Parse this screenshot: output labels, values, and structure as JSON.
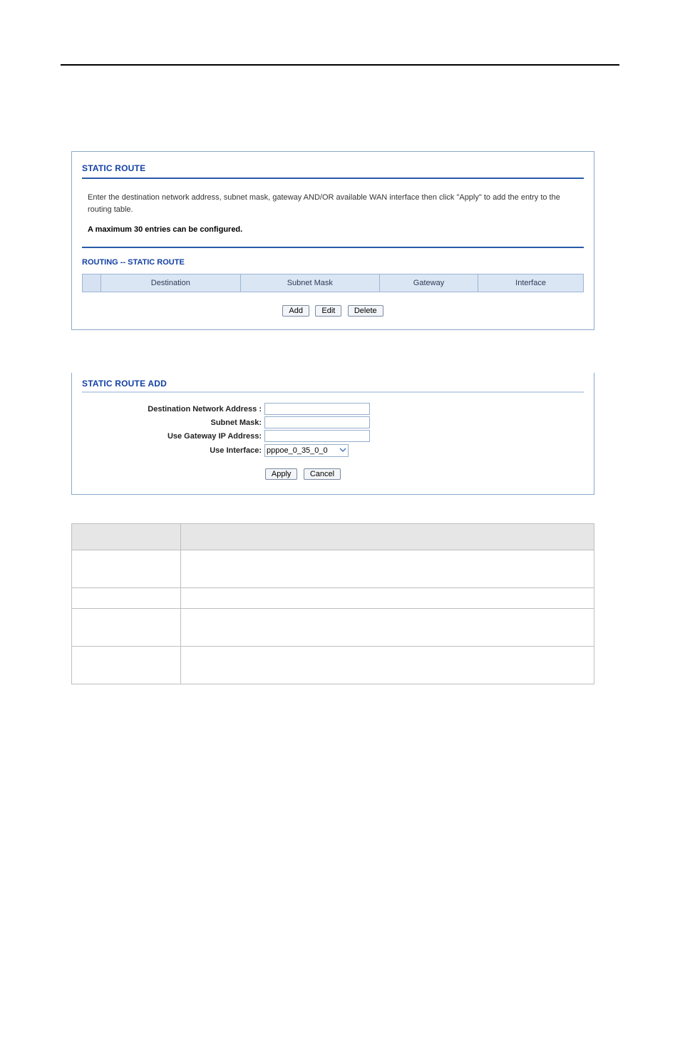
{
  "panel1": {
    "title": "STATIC ROUTE",
    "description": "Enter the destination network address, subnet mask, gateway AND/OR available WAN interface then click \"Apply\" to add the entry to the routing table.",
    "max_note": "A maximum 30 entries can be configured.",
    "subhead": "ROUTING -- STATIC ROUTE",
    "cols": {
      "destination": "Destination",
      "subnet_mask": "Subnet Mask",
      "gateway": "Gateway",
      "interface": "Interface"
    },
    "buttons": {
      "add": "Add",
      "edit": "Edit",
      "delete": "Delete"
    }
  },
  "panel2": {
    "title": "STATIC ROUTE ADD",
    "labels": {
      "dest": "Destination Network Address :",
      "mask": "Subnet Mask:",
      "gw": "Use Gateway IP Address:",
      "iface": "Use Interface:"
    },
    "iface_value": "pppoe_0_35_0_0",
    "buttons": {
      "apply": "Apply",
      "cancel": "Cancel"
    }
  }
}
